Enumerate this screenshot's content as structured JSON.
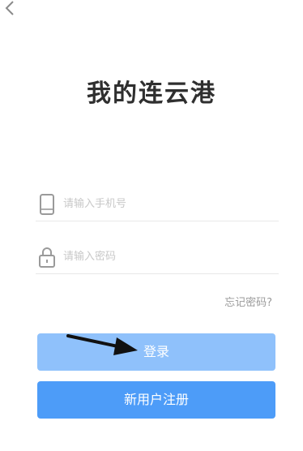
{
  "header": {
    "back_icon": "chevron-left-icon"
  },
  "title": "我的连云港",
  "form": {
    "phone": {
      "icon": "phone-icon",
      "placeholder": "请输入手机号",
      "value": ""
    },
    "password": {
      "icon": "lock-icon",
      "placeholder": "请输入密码",
      "value": ""
    },
    "forgot_label": "忘记密码?"
  },
  "buttons": {
    "login_label": "登录",
    "register_label": "新用户注册"
  },
  "colors": {
    "login_button": "#8fc1fb",
    "register_button": "#4d9cf8",
    "title_text": "#2f2f2f"
  },
  "annotation": {
    "icon": "arrow-right-icon"
  }
}
